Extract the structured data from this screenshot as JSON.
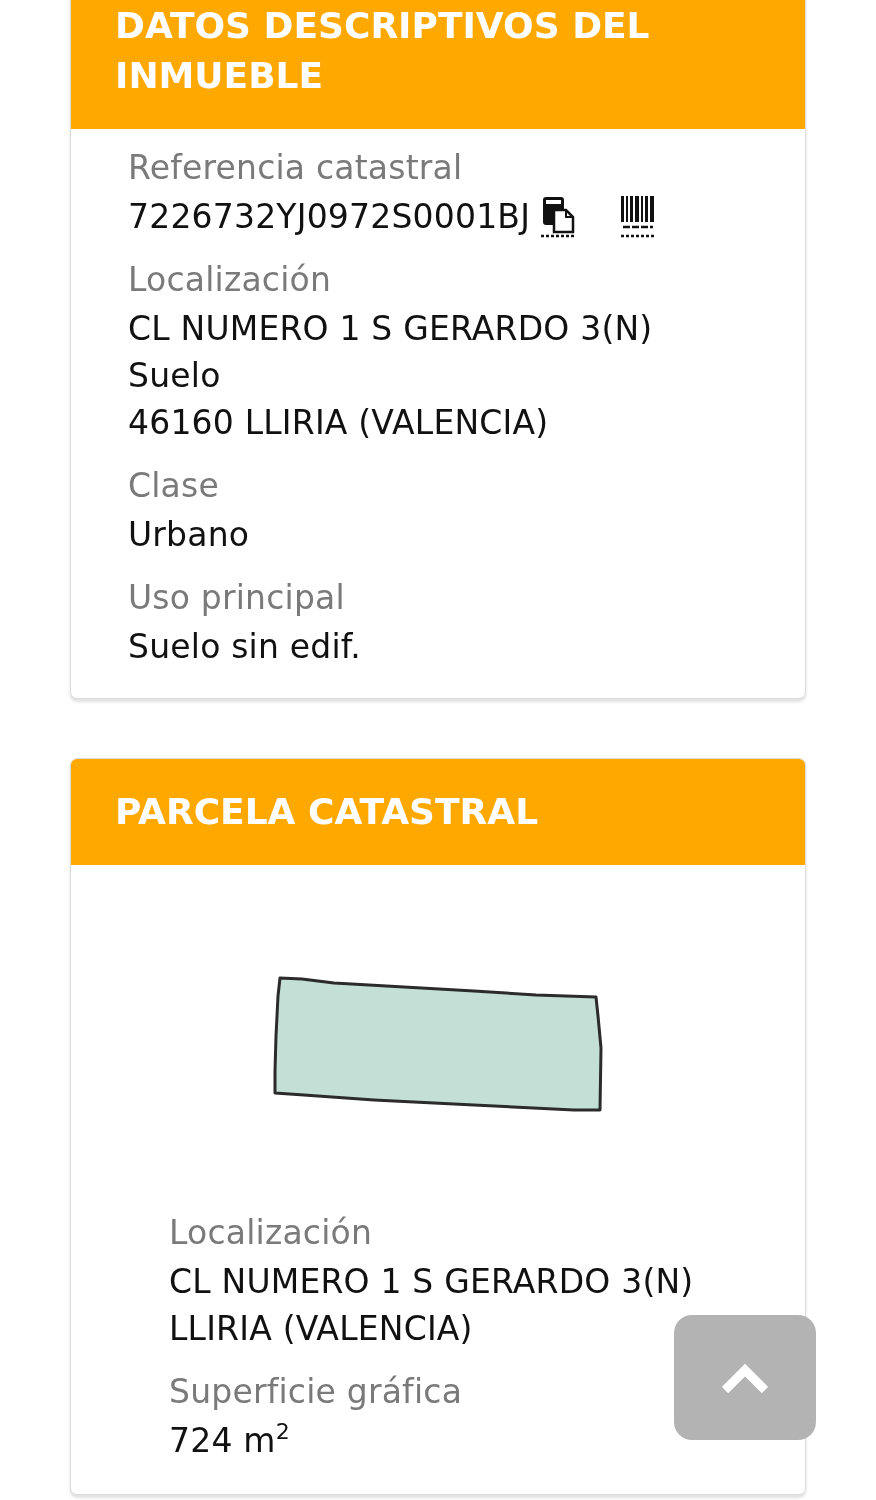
{
  "sections": [
    {
      "kind": "details",
      "title": "DATOS DESCRIPTIVOS DEL INMUEBLE",
      "fields": [
        {
          "kind": "reference",
          "label": "Referencia catastral",
          "lines": [
            "7226732YJ0972S0001BJ"
          ]
        },
        {
          "kind": "text",
          "label": "Localización",
          "lines": [
            "CL NUMERO 1 S GERARDO 3(N)",
            "Suelo",
            "46160 LLIRIA (VALENCIA)"
          ]
        },
        {
          "kind": "text",
          "label": "Clase",
          "lines": [
            "Urbano"
          ]
        },
        {
          "kind": "text",
          "label": "Uso principal",
          "lines": [
            "Suelo sin edif."
          ]
        }
      ]
    },
    {
      "kind": "parcel",
      "title": "PARCELA CATASTRAL",
      "fields": [
        {
          "kind": "text",
          "label": "Localización",
          "lines": [
            "CL NUMERO 1 S GERARDO 3(N)",
            "LLIRIA (VALENCIA)"
          ]
        },
        {
          "kind": "text",
          "label": "Superficie gráfica",
          "lines": [
            "724 m$^{2}$"
          ]
        }
      ]
    }
  ]
}
